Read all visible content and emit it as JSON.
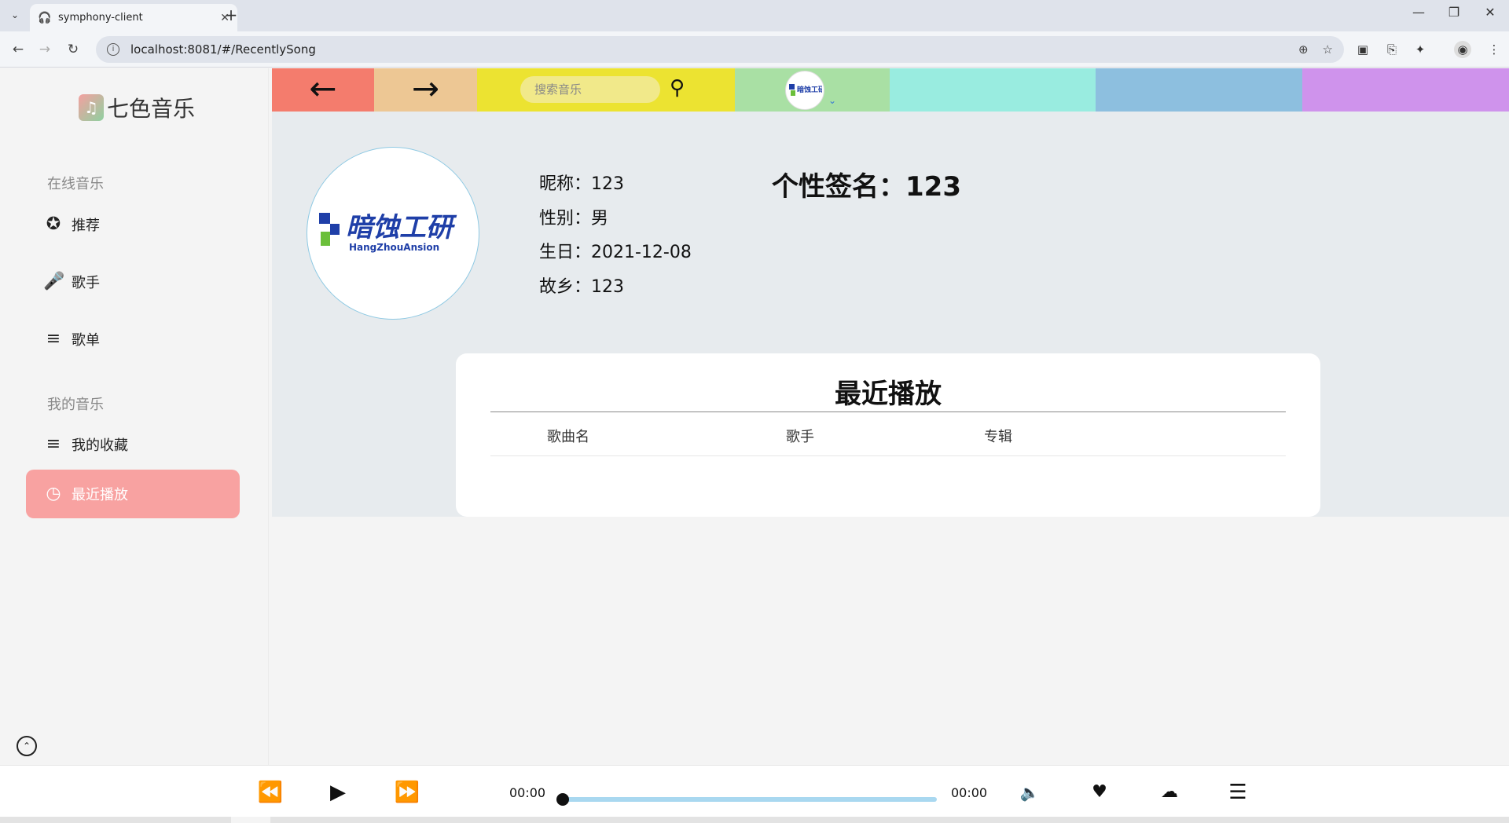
{
  "browser": {
    "tab_title": "symphony-client",
    "url": "localhost:8081/#/RecentlySong",
    "new_tab": "+",
    "close_tab": "✕"
  },
  "sidebar": {
    "logo_text": "七色音乐",
    "section_online": "在线音乐",
    "section_mine": "我的音乐",
    "items": [
      {
        "label": "推荐",
        "icon": "star-icon"
      },
      {
        "label": "歌手",
        "icon": "microphone-icon"
      },
      {
        "label": "歌单",
        "icon": "playlist-icon"
      },
      {
        "label": "我的收藏",
        "icon": "playlist-icon"
      },
      {
        "label": "最近播放",
        "icon": "clock-icon",
        "active": true
      }
    ]
  },
  "header": {
    "back_arrow": "←",
    "forward_arrow": "→",
    "search_placeholder": "搜索音乐",
    "colors": [
      "#f47c6d",
      "#edc794",
      "#ece331",
      "#a9e0a4",
      "#99ece0",
      "#8dbfdf",
      "#cf93ec"
    ]
  },
  "profile": {
    "nickname": "昵称：123",
    "gender": "性别：男",
    "birthday": "生日：2021-12-08",
    "hometown": "故乡：123",
    "signature": "个性签名：123",
    "avatar_logo_cn": "暗蚀工研",
    "avatar_logo_en": "HangZhouAnsion"
  },
  "recent": {
    "title": "最近播放",
    "columns": [
      "歌曲名",
      "歌手",
      "专辑"
    ]
  },
  "player": {
    "current_time": "00:00",
    "total_time": "00:00",
    "progress": 0
  }
}
